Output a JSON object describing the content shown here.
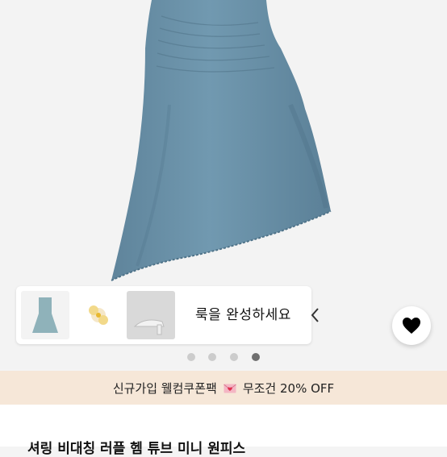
{
  "product_image": {
    "dress_color": "#6f95ab",
    "dress_shadow": "#5a7f96"
  },
  "look_strip": {
    "label": "룩을 완성하세요",
    "thumbnails": [
      {
        "name": "dress-thumbnail"
      },
      {
        "name": "hair-clip-thumbnail"
      },
      {
        "name": "sandal-thumbnail"
      }
    ],
    "arrow_icon": "chevron-left-icon"
  },
  "favorite": {
    "icon": "heart-icon",
    "color": "#000000"
  },
  "carousel": {
    "total": 4,
    "current": 4
  },
  "promo": {
    "text_before": "신규가입 웰컴쿠폰팩",
    "icon": "envelope-heart-icon",
    "text_after": "무조건 20% OFF",
    "background": "#f6e7d8"
  },
  "product": {
    "title": "셔링 비대칭 러플 헴 튜브 미니 원피스"
  }
}
